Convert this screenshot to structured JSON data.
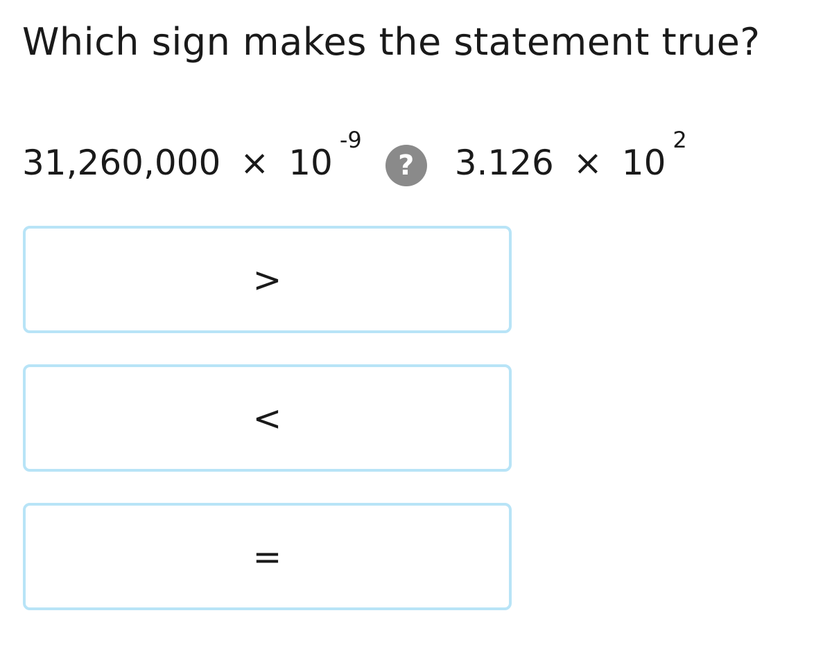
{
  "question": "Which sign makes the statement true?",
  "expression": {
    "left": {
      "mantissa": "31,260,000",
      "times": "×",
      "base": "10",
      "exponent": "-9"
    },
    "unknown_symbol": "?",
    "right": {
      "mantissa": "3.126",
      "times": "×",
      "base": "10",
      "exponent": "2"
    }
  },
  "choices": [
    {
      "label": ">"
    },
    {
      "label": "<"
    },
    {
      "label": "="
    }
  ],
  "colors": {
    "choice_border": "#b8e4f7",
    "badge_background": "#8a8a8a",
    "text": "#1a1a1a"
  },
  "icons": {
    "unknown": "question-mark-circle-icon"
  }
}
